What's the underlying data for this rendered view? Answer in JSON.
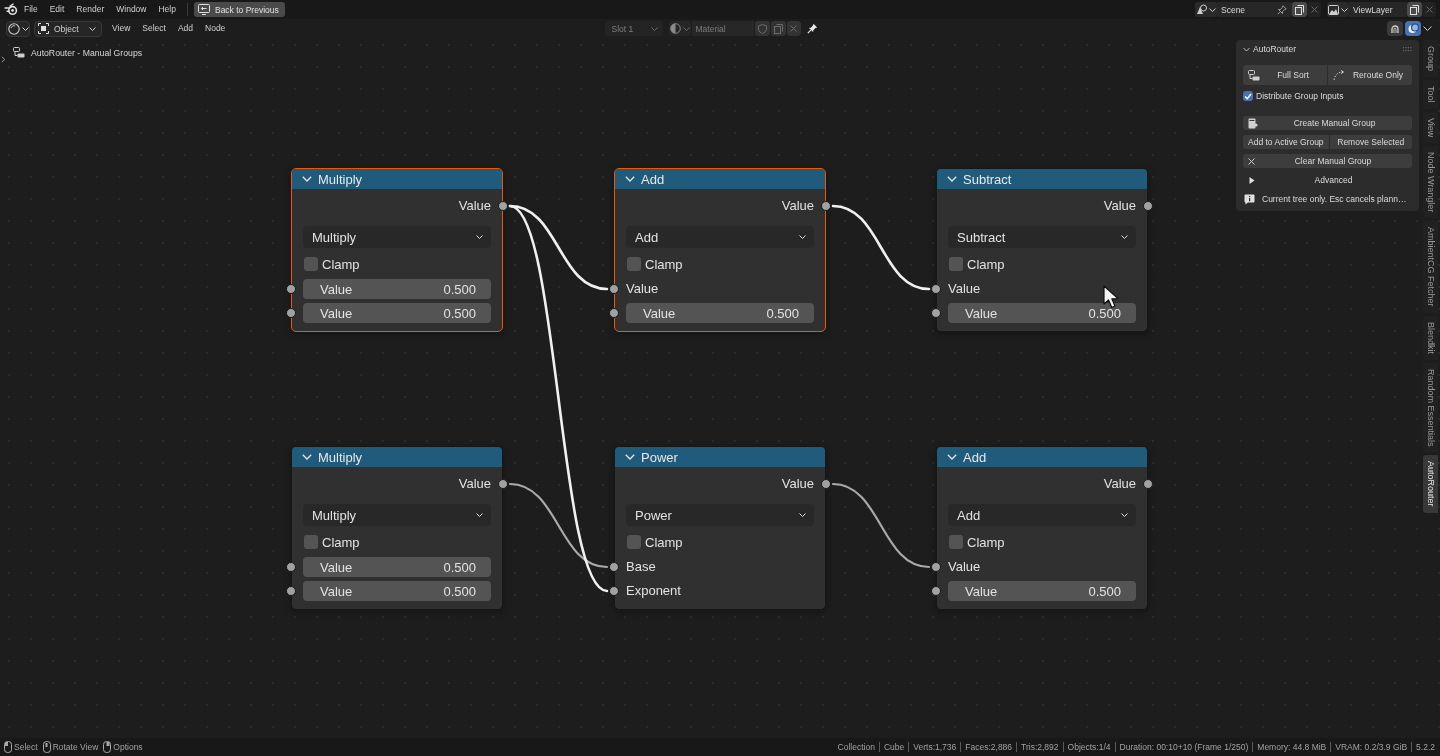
{
  "top_bar": {
    "menu": [
      "File",
      "Edit",
      "Render",
      "Window",
      "Help"
    ],
    "back_button": "Back to Previous",
    "scene": "Scene",
    "view_layer": "ViewLayer"
  },
  "header": {
    "mode": "Object",
    "menu": [
      "View",
      "Select",
      "Add",
      "Node"
    ],
    "slot": {
      "label": "Slot 1",
      "disabled": true
    },
    "material": {
      "label": "Material",
      "disabled": true
    },
    "toggles": [
      {
        "kind": "snap",
        "on": false
      },
      {
        "kind": "overlay",
        "on": true
      }
    ]
  },
  "breadcrumb": "AutoRouter - Manual Groups",
  "nodes": [
    {
      "title": "Multiply",
      "selected": true,
      "output": "Value",
      "operation": "Multiply",
      "clamp": {
        "label": "Clamp",
        "checked": false
      },
      "inputs": [
        {
          "label": "Value",
          "linked": false,
          "value": "0.500"
        },
        {
          "label": "Value",
          "linked": false,
          "value": "0.500"
        }
      ]
    },
    {
      "title": "Add",
      "selected": true,
      "output": "Value",
      "operation": "Add",
      "clamp": {
        "label": "Clamp",
        "checked": false
      },
      "inputs": [
        {
          "label": "Value",
          "linked": true,
          "from_upper_row": false
        },
        {
          "label": "Value",
          "linked": false,
          "value": "0.500"
        }
      ]
    },
    {
      "title": "Subtract",
      "selected": false,
      "output": "Value",
      "operation": "Subtract",
      "clamp": {
        "label": "Clamp",
        "checked": false
      },
      "inputs": [
        {
          "label": "Value",
          "linked": true,
          "from_upper_row": false
        },
        {
          "label": "Value",
          "linked": false,
          "value": "0.500"
        }
      ]
    },
    {
      "title": "Multiply",
      "selected": false,
      "output": "Value",
      "operation": "Multiply",
      "clamp": {
        "label": "Clamp",
        "checked": false
      },
      "inputs": [
        {
          "label": "Value",
          "linked": false,
          "value": "0.500"
        },
        {
          "label": "Value",
          "linked": false,
          "value": "0.500"
        }
      ]
    },
    {
      "title": "Power",
      "selected": false,
      "output": "Value",
      "operation": "Power",
      "clamp": {
        "label": "Clamp",
        "checked": false
      },
      "inputs": [
        {
          "label": "Base",
          "linked": true,
          "from_upper_row": false
        },
        {
          "label": "Exponent",
          "linked": true,
          "from_upper_row": true
        }
      ]
    },
    {
      "title": "Add",
      "selected": false,
      "output": "Value",
      "operation": "Add",
      "clamp": {
        "label": "Clamp",
        "checked": false
      },
      "inputs": [
        {
          "label": "Value",
          "linked": true,
          "from_upper_row": false
        },
        {
          "label": "Value",
          "linked": false,
          "value": "0.500"
        }
      ]
    }
  ],
  "sidebar": {
    "title": "AutoRouter",
    "expanded": true,
    "sort_buttons": [
      {
        "kind": "sort",
        "label": "Full Sort"
      },
      {
        "kind": "reroute",
        "label": "Reroute Only"
      }
    ],
    "distribute": {
      "label": "Distribute Group Inputs",
      "checked": true
    },
    "create_button": "Create Manual Group",
    "group_buttons": [
      "Add to Active Group",
      "Remove Selected"
    ],
    "clear_button": "Clear Manual Group",
    "advanced": {
      "label": "Advanced",
      "expanded": false
    },
    "info": "Current tree only. Esc cancels plann…"
  },
  "sidebar_tabs": [
    {
      "label": "Group",
      "selected": false
    },
    {
      "label": "Tool",
      "selected": false
    },
    {
      "label": "View",
      "selected": false
    },
    {
      "label": "Node Wrangler",
      "selected": false
    },
    {
      "label": "AmbientCG Fetcher",
      "selected": false
    },
    {
      "label": "Blendkit",
      "selected": false
    },
    {
      "label": "Random Essentials",
      "selected": false
    },
    {
      "label": "AutoRouter",
      "selected": true
    }
  ],
  "status_bar": {
    "hints": [
      {
        "kind": "left",
        "label": "Select"
      },
      {
        "kind": "middle",
        "label": "Rotate View"
      },
      {
        "kind": "right",
        "label": "Options"
      }
    ],
    "stats": [
      "Collection",
      "Cube",
      "Verts:1,736",
      "Faces:2,886",
      "Tris:2,892",
      "Objects:1/4",
      "Duration: 00:10+10 (Frame 1/250)",
      "Memory: 44.8 MiB",
      "VRAM: 0.2/3.9 GiB",
      "5.2.2"
    ]
  }
}
